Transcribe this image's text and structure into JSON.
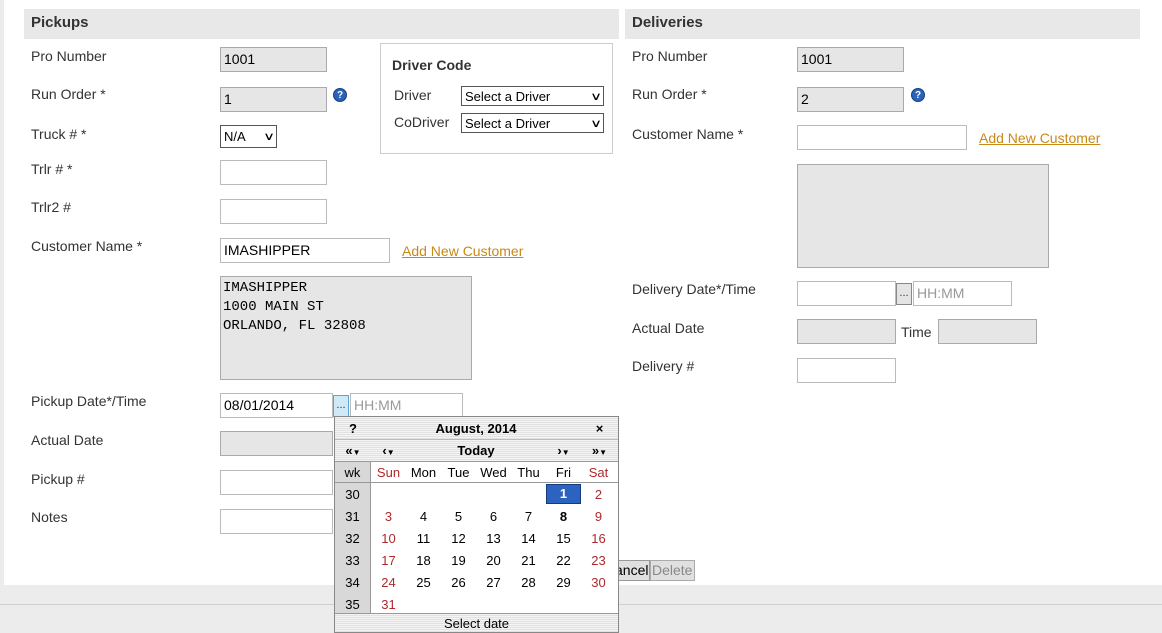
{
  "pickups": {
    "title": "Pickups",
    "pro_label": "Pro Number",
    "pro_value": "1001",
    "run_label": "Run Order *",
    "run_value": "1",
    "truck_label": "Truck # *",
    "truck_value": "N/A",
    "trlr_label": "Trlr # *",
    "trlr2_label": "Trlr2 #",
    "customer_label": "Customer Name *",
    "customer_value": "IMASHIPPER",
    "add_customer": "Add New Customer",
    "address": "IMASHIPPER\n1000 MAIN ST\nORLANDO, FL 32808",
    "date_label": "Pickup Date*/Time",
    "date_value": "08/01/2014",
    "time_placeholder": "HH:MM",
    "actual_label": "Actual Date",
    "pickupnum_label": "Pickup #",
    "notes_label": "Notes"
  },
  "driver": {
    "title": "Driver Code",
    "driver_label": "Driver",
    "driver_value": "Select a Driver",
    "codriver_label": "CoDriver",
    "codriver_value": "Select a Driver"
  },
  "deliveries": {
    "title": "Deliveries",
    "pro_label": "Pro Number",
    "pro_value": "1001",
    "run_label": "Run Order *",
    "run_value": "2",
    "customer_label": "Customer Name *",
    "add_customer": "Add New Customer",
    "date_label": "Delivery Date*/Time",
    "time_placeholder": "HH:MM",
    "actual_label": "Actual Date",
    "time_label": "Time",
    "deliverynum_label": "Delivery #"
  },
  "buttons": {
    "cancel": "ancel",
    "delete": "Delete"
  },
  "calendar": {
    "help": "?",
    "month": "August, 2014",
    "close": "×",
    "prev_year": "«",
    "prev_month": "‹",
    "today": "Today",
    "next_month": "›",
    "next_year": "»",
    "wk": "wk",
    "weekdays": [
      "Sun",
      "Mon",
      "Tue",
      "Wed",
      "Thu",
      "Fri",
      "Sat"
    ],
    "weeks": [
      {
        "wk": "30",
        "days": [
          "",
          "",
          "",
          "",
          "",
          "1",
          "2"
        ]
      },
      {
        "wk": "31",
        "days": [
          "3",
          "4",
          "5",
          "6",
          "7",
          "8",
          "9"
        ]
      },
      {
        "wk": "32",
        "days": [
          "10",
          "11",
          "12",
          "13",
          "14",
          "15",
          "16"
        ]
      },
      {
        "wk": "33",
        "days": [
          "17",
          "18",
          "19",
          "20",
          "21",
          "22",
          "23"
        ]
      },
      {
        "wk": "34",
        "days": [
          "24",
          "25",
          "26",
          "27",
          "28",
          "29",
          "30"
        ]
      },
      {
        "wk": "35",
        "days": [
          "31",
          "",
          "",
          "",
          "",
          "",
          ""
        ]
      }
    ],
    "selected": "1",
    "today_day": "8",
    "status": "Select date"
  },
  "help_icon": "?",
  "dots": "..."
}
